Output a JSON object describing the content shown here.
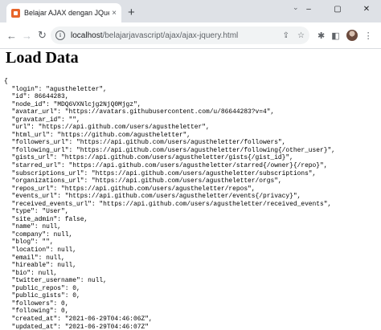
{
  "browser": {
    "tab_title": "Belajar AJAX dengan JQuery",
    "tab_close": "×",
    "new_tab": "+",
    "window_controls": [
      "–",
      "▢",
      "✕"
    ],
    "url_host": "localhost",
    "url_path": "/belajarjavascript/ajax/ajax-jquery.html"
  },
  "page": {
    "heading": "Load Data",
    "json_lines": [
      "{",
      "  \"login\": \"agustheletter\",",
      "  \"id\": 86644283,",
      "  \"node_id\": \"MDQ6VXNlcjg2NjQ0Mjgz\",",
      "  \"avatar_url\": \"https://avatars.githubusercontent.com/u/86644283?v=4\",",
      "  \"gravatar_id\": \"\",",
      "  \"url\": \"https://api.github.com/users/agustheletter\",",
      "  \"html_url\": \"https://github.com/agustheletter\",",
      "  \"followers_url\": \"https://api.github.com/users/agustheletter/followers\",",
      "  \"following_url\": \"https://api.github.com/users/agustheletter/following{/other_user}\",",
      "  \"gists_url\": \"https://api.github.com/users/agustheletter/gists{/gist_id}\",",
      "  \"starred_url\": \"https://api.github.com/users/agustheletter/starred{/owner}{/repo}\",",
      "  \"subscriptions_url\": \"https://api.github.com/users/agustheletter/subscriptions\",",
      "  \"organizations_url\": \"https://api.github.com/users/agustheletter/orgs\",",
      "  \"repos_url\": \"https://api.github.com/users/agustheletter/repos\",",
      "  \"events_url\": \"https://api.github.com/users/agustheletter/events{/privacy}\",",
      "  \"received_events_url\": \"https://api.github.com/users/agustheletter/received_events\",",
      "  \"type\": \"User\",",
      "  \"site_admin\": false,",
      "  \"name\": null,",
      "  \"company\": null,",
      "  \"blog\": \"\",",
      "  \"location\": null,",
      "  \"email\": null,",
      "  \"hireable\": null,",
      "  \"bio\": null,",
      "  \"twitter_username\": null,",
      "  \"public_repos\": 0,",
      "  \"public_gists\": 0,",
      "  \"followers\": 0,",
      "  \"following\": 0,",
      "  \"created_at\": \"2021-06-29T04:46:06Z\",",
      "  \"updated_at\": \"2021-06-29T04:46:07Z\"",
      "}"
    ]
  }
}
